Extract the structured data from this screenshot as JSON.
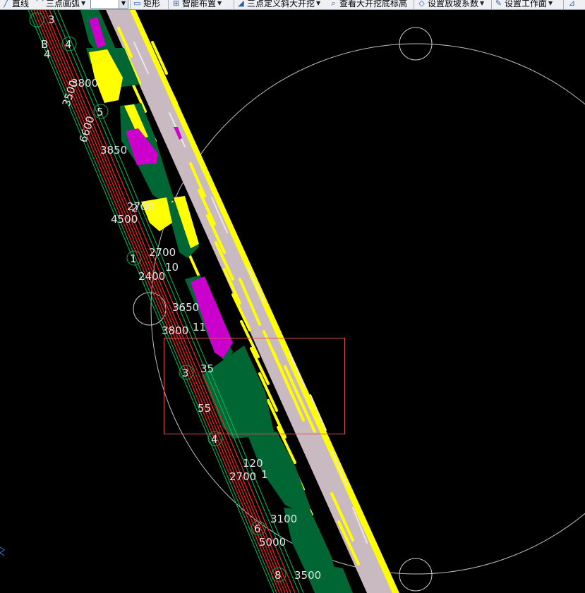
{
  "toolbar": {
    "items": [
      {
        "label": "直线",
        "icon": "line-icon",
        "dropdown": false
      },
      {
        "label": "三点画弧",
        "icon": "arc-icon",
        "dropdown": true
      },
      {
        "label": "矩形",
        "icon": "rectangle-icon",
        "dropdown": false
      },
      {
        "label": "智能布置",
        "icon": "smart-layout-icon",
        "dropdown": true
      },
      {
        "label": "三点定义斜大开挖",
        "icon": "excavation-icon",
        "dropdown": true
      },
      {
        "label": "查看大开挖底标高",
        "icon": "view-elevation-icon",
        "dropdown": false
      },
      {
        "label": "设置放坡系数",
        "icon": "slope-icon",
        "dropdown": true
      },
      {
        "label": "设置工作面",
        "icon": "workface-icon",
        "dropdown": true
      }
    ],
    "combo_value": ""
  },
  "drawing": {
    "axis_markers": [
      "4",
      "5",
      "1",
      "3",
      "4",
      "6",
      "8"
    ],
    "dimensions": [
      "3800",
      "3850",
      "2700",
      "4500",
      "2700",
      "2400",
      "3650",
      "3800",
      "2700",
      "3100",
      "5000",
      "3500"
    ],
    "partial_labels": [
      "3",
      "B",
      "4",
      "2",
      "10",
      "11",
      "35",
      "55",
      "120",
      "1"
    ],
    "vertical_texts": [
      "3500",
      "6600"
    ],
    "selection_box_color": "#e05050",
    "colors": {
      "green_fill": "#006633",
      "yellow": "#ffff00",
      "magenta": "#cc00cc",
      "red_axis": "#ff2020",
      "gray_fill": "#c7b8bf",
      "circle_stroke": "#bfbfbf"
    }
  }
}
